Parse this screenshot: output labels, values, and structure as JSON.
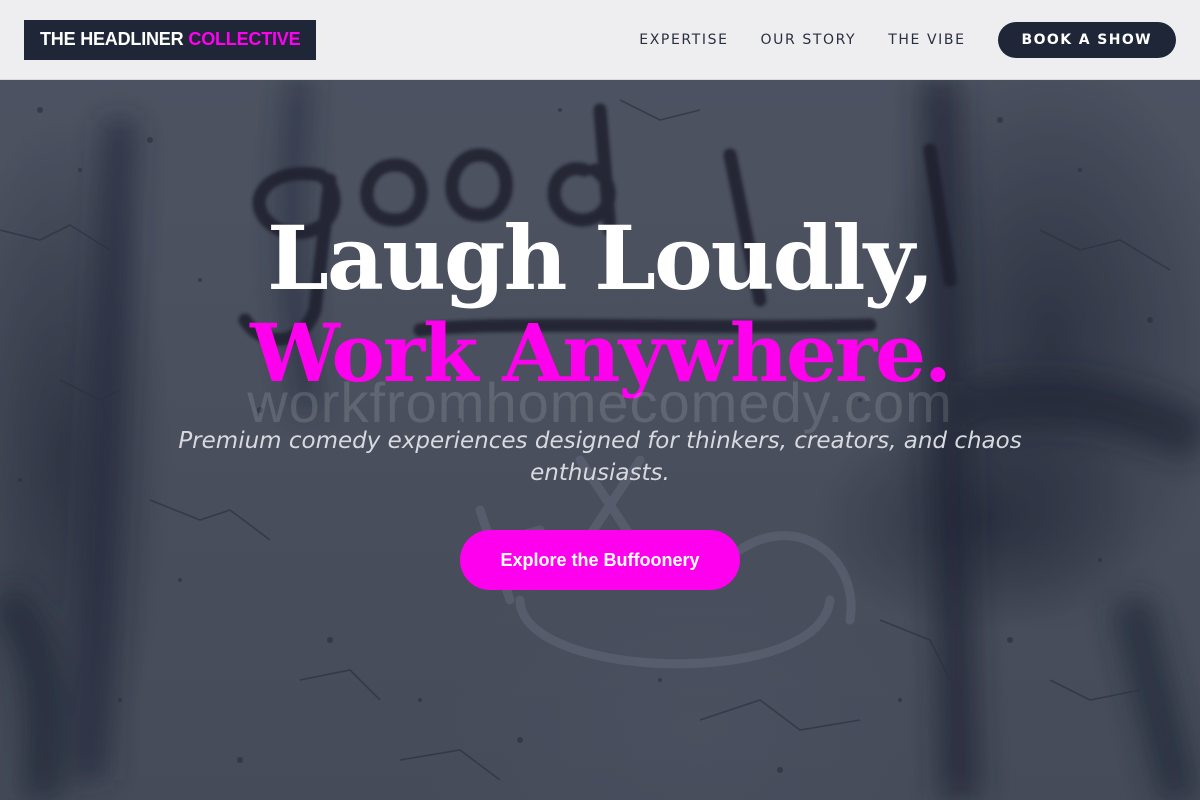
{
  "header": {
    "logo_part1": "THE HEADLINER",
    "logo_part2": "COLLECTIVE",
    "nav": [
      {
        "label": "EXPERTISE"
      },
      {
        "label": "OUR STORY"
      },
      {
        "label": "THE VIBE"
      }
    ],
    "cta_label": "BOOK A SHOW"
  },
  "hero": {
    "headline_line1": "Laugh Loudly,",
    "headline_line2": "Work Anywhere.",
    "watermark": "workfromhomecomedy.com",
    "subtitle": "Premium comedy experiences designed for thinkers, creators, and chaos enthusiasts.",
    "cta_label": "Explore the Buffoonery",
    "background_image": "graffiti-wall"
  },
  "colors": {
    "accent": "#ff00ee",
    "navy": "#1e2638",
    "header_bg": "#eeeef0"
  }
}
